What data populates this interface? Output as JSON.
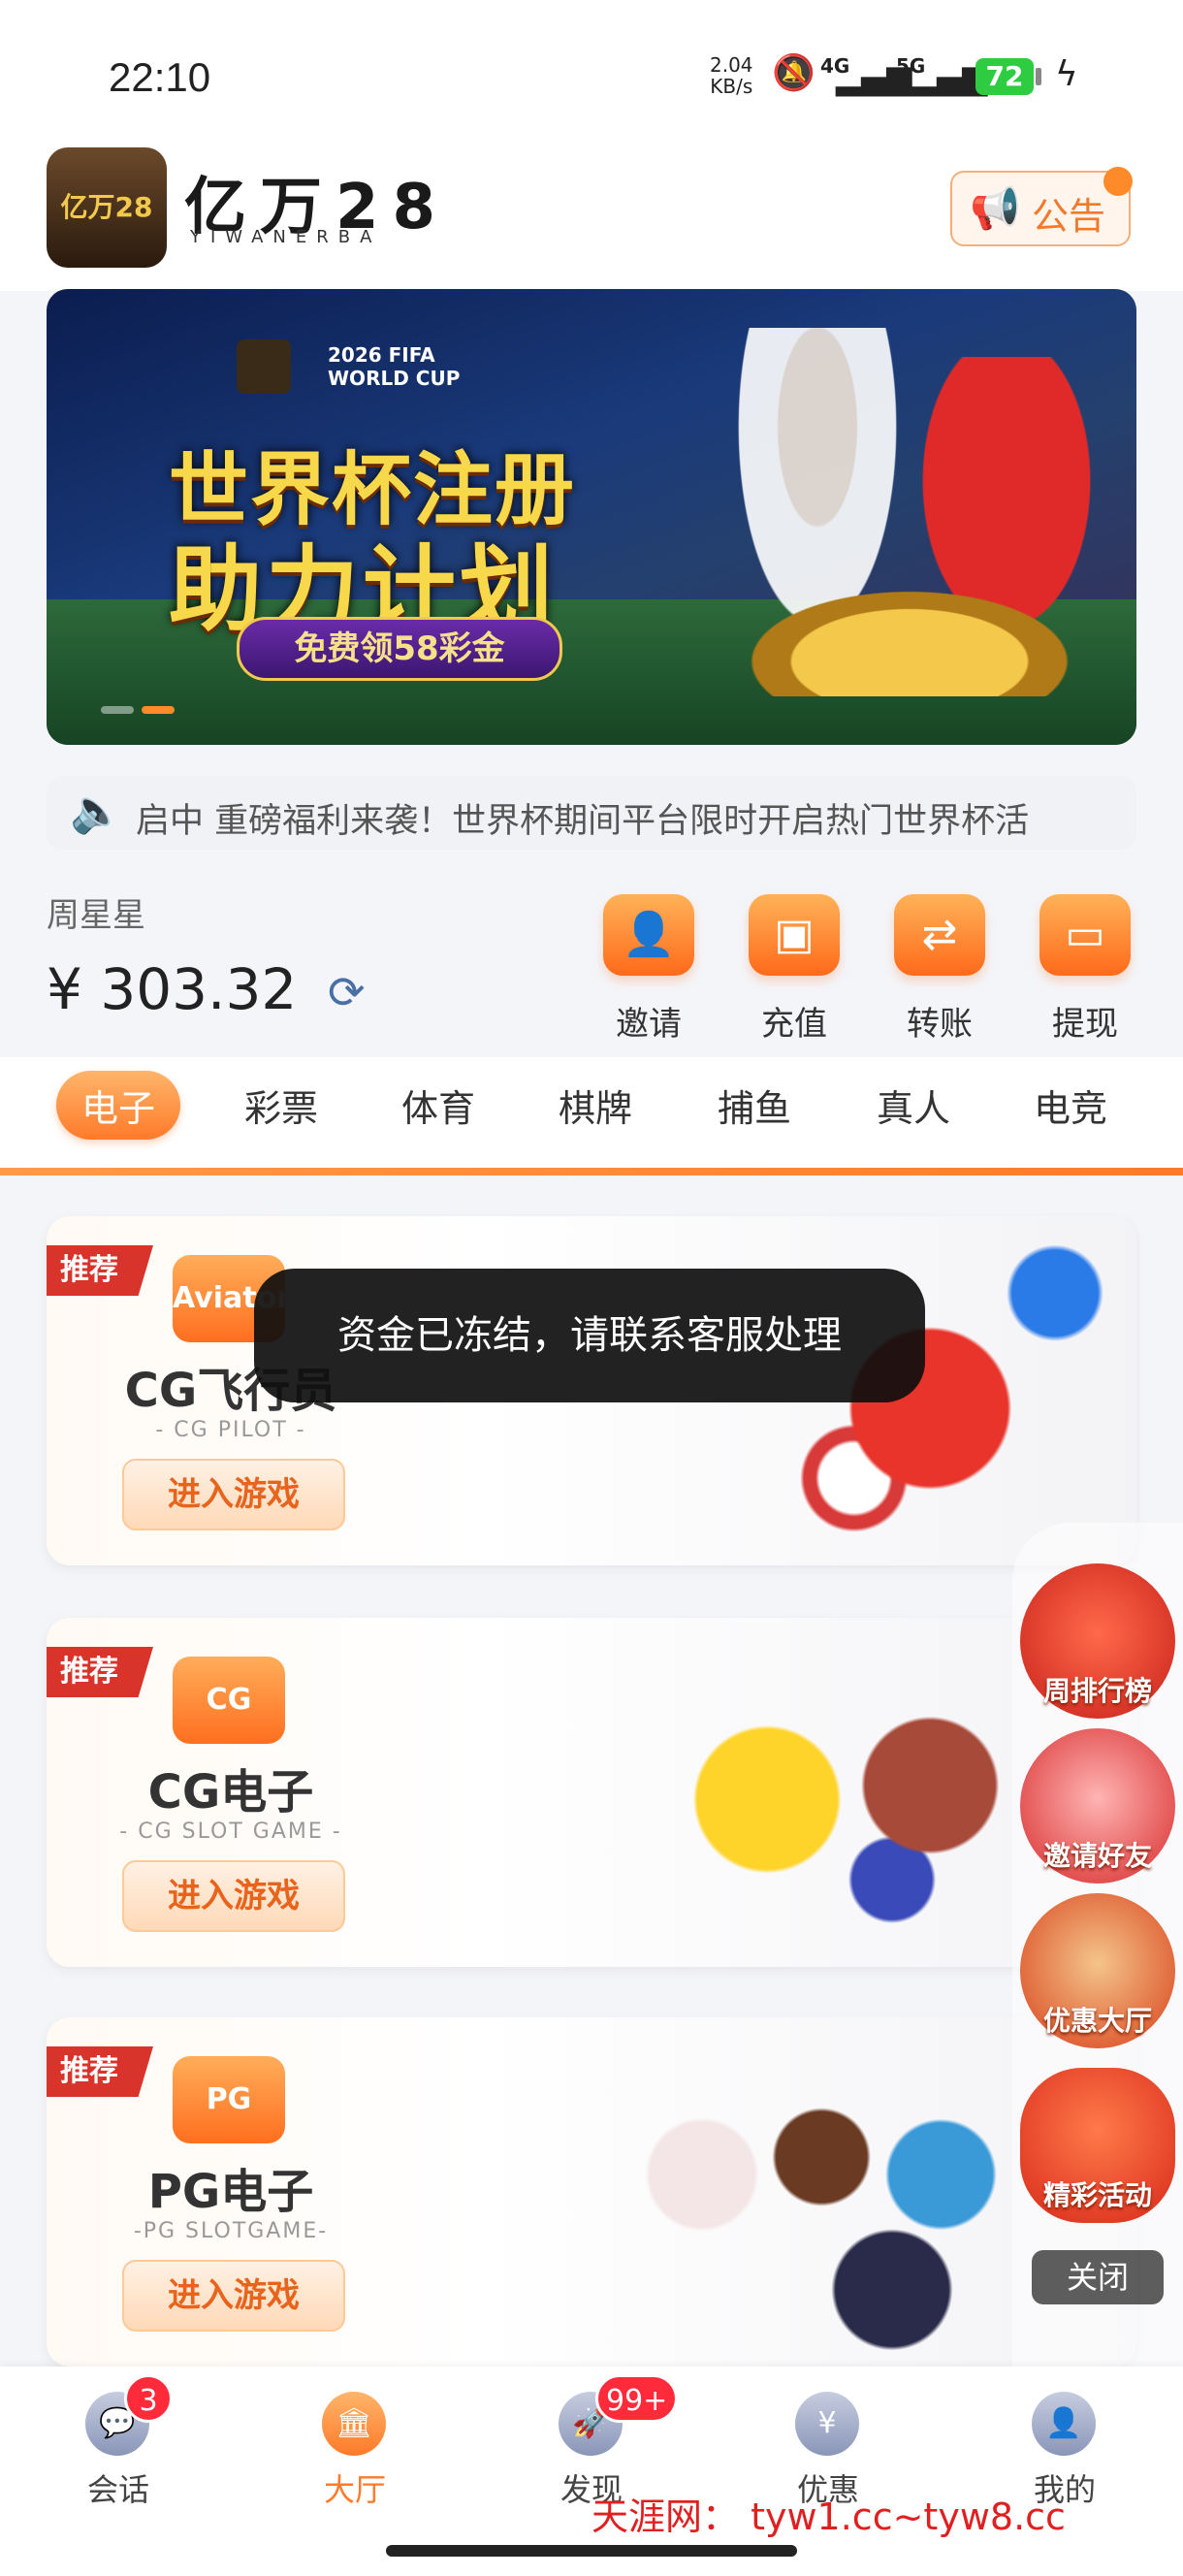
{
  "status_bar": {
    "time": "22:10",
    "speed_value": "2.04",
    "speed_unit": "KB/s",
    "net1": "4G",
    "net2": "5G",
    "battery": "72"
  },
  "header": {
    "title": "亿万28",
    "subtitle": "YIWANERBA",
    "logo_text": "亿万28",
    "notice_label": "公告"
  },
  "banner": {
    "badge_line1": "2026 FIFA",
    "badge_line2": "WORLD CUP",
    "headline1": "世界杯注册",
    "headline2": "助力计划",
    "ribbon": "免费领58彩金"
  },
  "marquee": {
    "text": "启中 重磅福利来袭！世界杯期间平台限时开启热门世界杯活"
  },
  "account": {
    "username": "周星星",
    "balance": "¥ 303.32"
  },
  "quick_actions": [
    {
      "label": "邀请"
    },
    {
      "label": "充值"
    },
    {
      "label": "转账"
    },
    {
      "label": "提现"
    }
  ],
  "categories": [
    "电子",
    "彩票",
    "体育",
    "棋牌",
    "捕鱼",
    "真人",
    "电竞"
  ],
  "games": [
    {
      "tag": "推荐",
      "icon_text": "Aviator",
      "name": "CG飞行员",
      "sub": "- CG PILOT -",
      "enter": "进入游戏"
    },
    {
      "tag": "推荐",
      "icon_text": "CG",
      "name": "CG电子",
      "sub": "- CG SLOT GAME -",
      "enter": "进入游戏"
    },
    {
      "tag": "推荐",
      "icon_text": "PG",
      "name": "PG电子",
      "sub": "-PG SLOTGAME-",
      "enter": "进入游戏"
    }
  ],
  "toast": "资金已冻结，请联系客服处理",
  "floating": {
    "items": [
      {
        "label": "周排行榜"
      },
      {
        "label": "邀请好友"
      },
      {
        "label": "优惠大厅"
      },
      {
        "label": "精彩活动"
      }
    ],
    "close": "关闭"
  },
  "bottom_nav": [
    {
      "label": "会话",
      "badge": "3"
    },
    {
      "label": "大厅"
    },
    {
      "label": "发现",
      "badge": "99+"
    },
    {
      "label": "优惠"
    },
    {
      "label": "我的"
    }
  ],
  "watermark": "天涯网： tyw1.cc~tyw8.cc"
}
